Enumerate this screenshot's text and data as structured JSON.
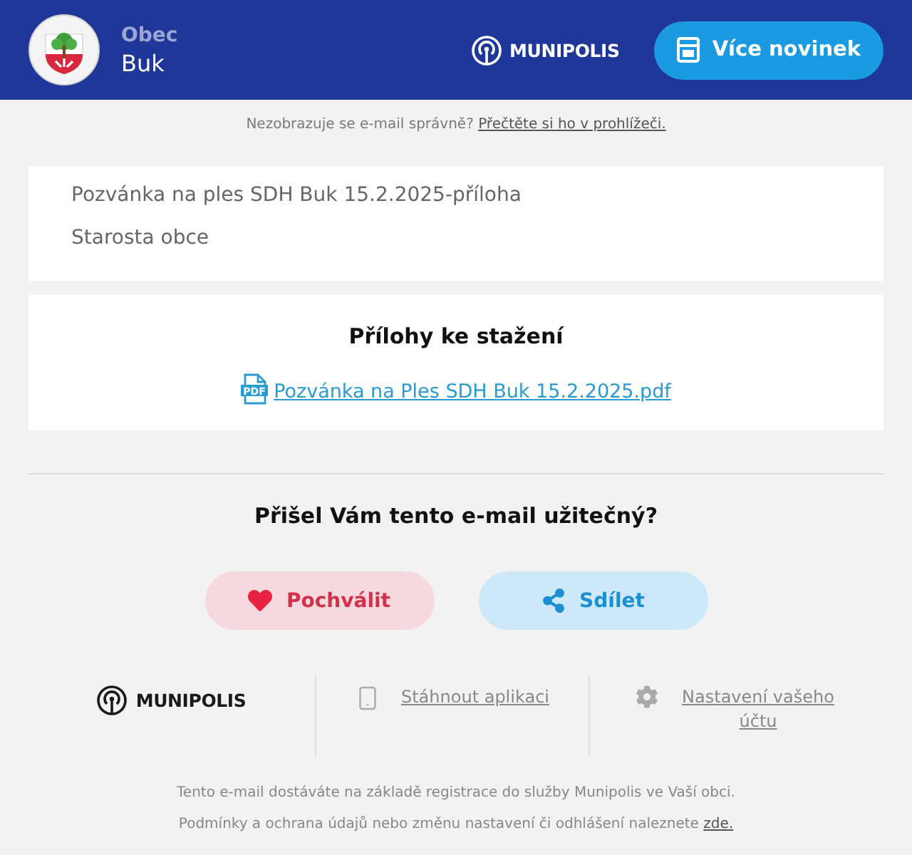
{
  "header": {
    "municipality": {
      "label": "Obec",
      "name": "Buk"
    },
    "brand": "MUNIPOLIS",
    "news_button": "Více novinek"
  },
  "browser_notice": {
    "text": "Nezobrazuje se e-mail správně?",
    "link": "Přečtěte si ho v prohlížeči."
  },
  "message": {
    "lines": [
      "Pozvánka na ples SDH Buk 15.2.2025-příloha",
      "Starosta obce"
    ]
  },
  "attachments": {
    "title": "Přílohy ke stažení",
    "files": [
      {
        "kind": "pdf",
        "icon_text": "PDF",
        "name": "Pozvánka na Ples SDH Buk 15.2.2025.pdf"
      }
    ]
  },
  "feedback": {
    "question": "Přišel Vám tento e-mail užitečný?",
    "buttons": [
      {
        "kind": "praise",
        "label": "Pochválit"
      },
      {
        "kind": "share",
        "label": "Sdílet"
      }
    ]
  },
  "footer": {
    "brand": "MUNIPOLIS",
    "links": [
      {
        "kind": "app",
        "label": "Stáhnout aplikaci"
      },
      {
        "kind": "settings",
        "label": "Nastavení vašeho účtu"
      }
    ],
    "notes": [
      {
        "text": "Tento e-mail dostáváte na základě registrace do služby Munipolis ve Vaší obci."
      },
      {
        "text": "Podmínky a ochrana údajů nebo změnu nastavení či odhlášení naleznete",
        "link": "zde."
      }
    ]
  }
}
